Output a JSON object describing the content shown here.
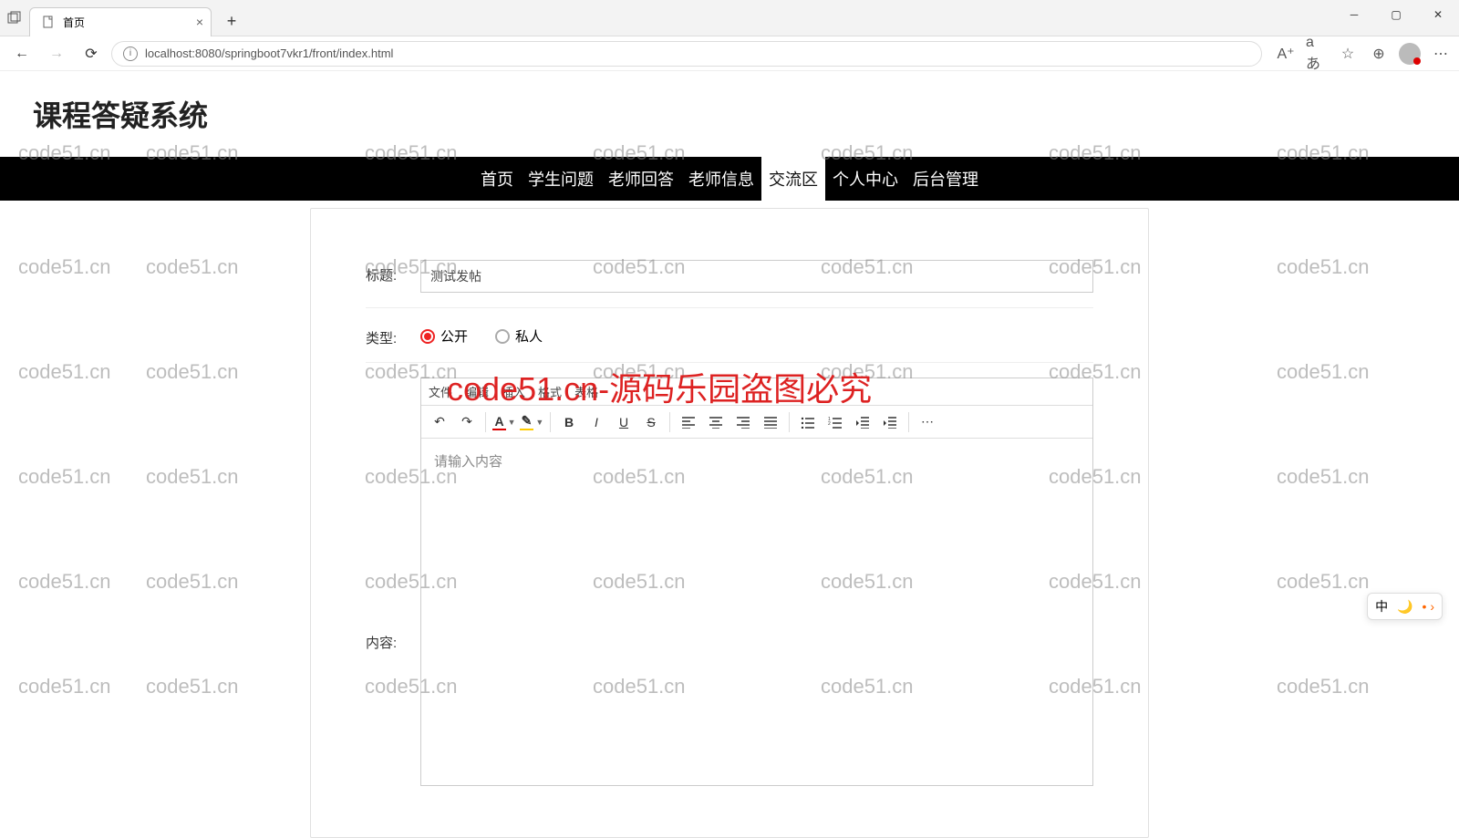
{
  "browser": {
    "tab_title": "首页",
    "url": "localhost:8080/springboot7vkr1/front/index.html"
  },
  "site": {
    "title": "课程答疑系统"
  },
  "nav": {
    "items": [
      "首页",
      "学生问题",
      "老师回答",
      "老师信息",
      "交流区",
      "个人中心",
      "后台管理"
    ],
    "active_index": 4
  },
  "form": {
    "title_label": "标题:",
    "title_value": "测试发帖",
    "type_label": "类型:",
    "type_options": [
      "公开",
      "私人"
    ],
    "type_selected": 0,
    "content_label": "内容:",
    "editor_placeholder": "请输入内容",
    "editor_menus": [
      "文件",
      "编辑",
      "插入",
      "格式",
      "表格"
    ]
  },
  "ime": {
    "lang": "中",
    "moon": "🌙",
    "dots": "• ›"
  },
  "watermark_text": "code51.cn",
  "watermark_big": "code51.cn-源码乐园盗图必究"
}
